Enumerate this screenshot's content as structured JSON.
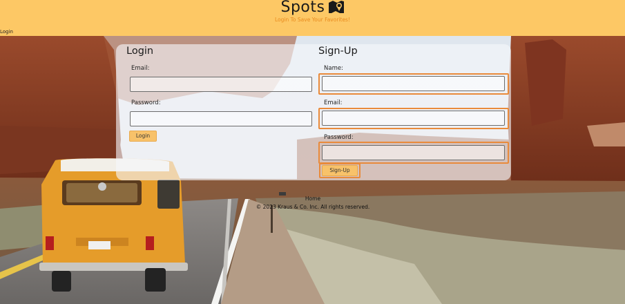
{
  "header": {
    "brand": "Spots",
    "brand_icon": "map-icon",
    "tagline": "Login To Save Your Favorites!",
    "nav_login": "Login"
  },
  "login": {
    "title": "Login",
    "email_label": "Email:",
    "email_value": "",
    "password_label": "Password:",
    "password_value": "",
    "button": "Login"
  },
  "signup": {
    "title": "Sign-Up",
    "name_label": "Name:",
    "name_value": "",
    "email_label": "Email:",
    "email_value": "",
    "password_label": "Password:",
    "password_value": "",
    "button": "Sign-Up"
  },
  "footer": {
    "home": "Home",
    "copyright": "© 2023 Kraus & Co. Inc. All rights reserved."
  },
  "colors": {
    "header_bg": "#fdc865",
    "accent": "#e98a1d",
    "highlight_outline": "#e98a3a",
    "button_bg": "#f8c26a"
  }
}
